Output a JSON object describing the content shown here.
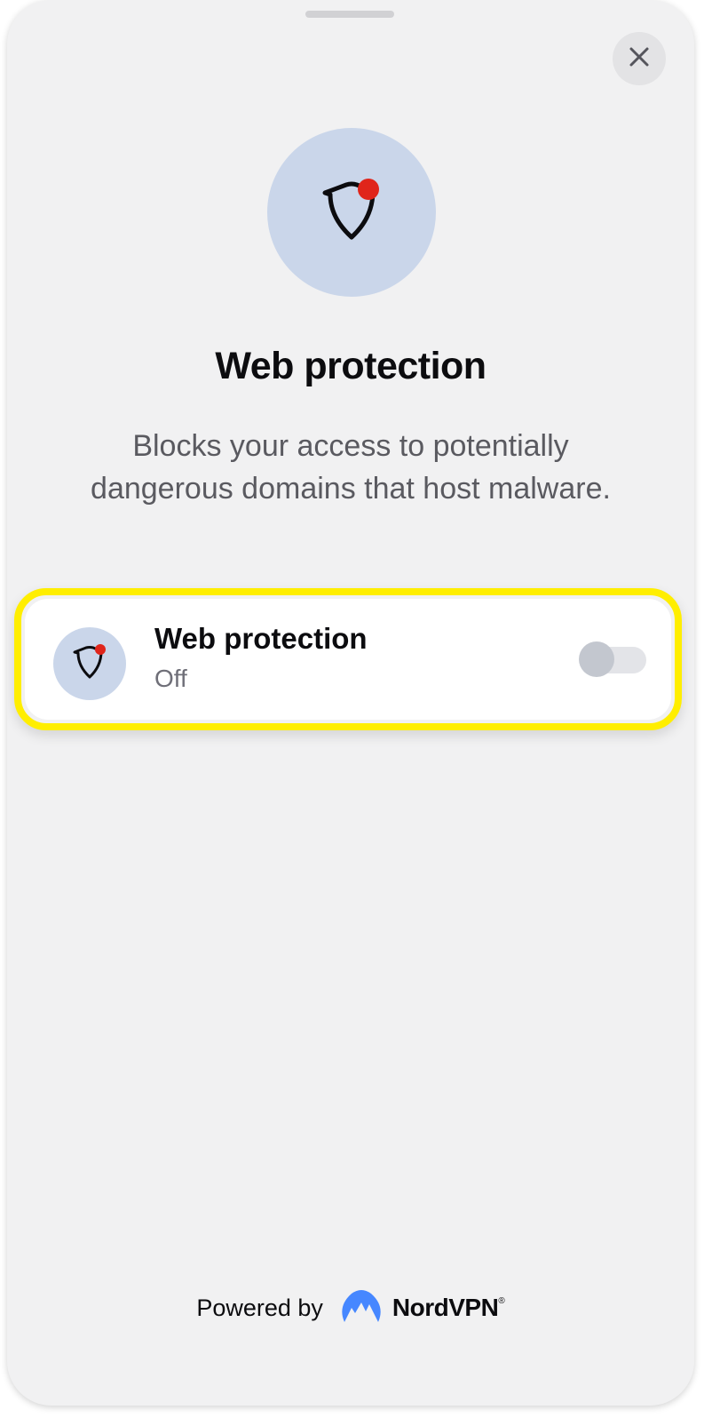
{
  "header": {
    "title": "Web protection",
    "description": "Blocks your access to potentially dangerous domains that host malware."
  },
  "setting": {
    "title": "Web protection",
    "status": "Off",
    "enabled": false
  },
  "footer": {
    "powered_by": "Powered by",
    "brand": "NordVPN",
    "registered": "®"
  },
  "icons": {
    "close": "close-icon",
    "hero": "shield-alert-icon",
    "setting": "shield-alert-icon",
    "brand": "nordvpn-logo-icon"
  },
  "colors": {
    "highlight": "#ffee00",
    "alert_dot": "#e0251b",
    "icon_bg": "#cad6ea",
    "brand_blue": "#4687ff"
  }
}
